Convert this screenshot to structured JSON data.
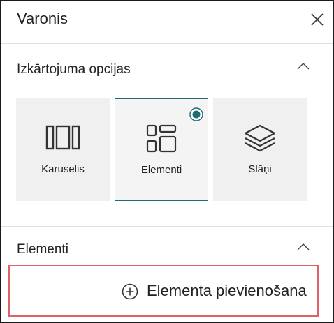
{
  "panel": {
    "title": "Varonis",
    "close_icon": "close-icon"
  },
  "layout_section": {
    "title": "Izkārtojuma opcijas",
    "chevron_icon": "chevron-up-icon",
    "options": [
      {
        "label": "Karuselis",
        "icon": "carousel-icon",
        "selected": false
      },
      {
        "label": "Elementi",
        "icon": "grid-icon",
        "selected": true
      },
      {
        "label": "Slāņi",
        "icon": "layers-icon",
        "selected": false
      }
    ]
  },
  "elements_section": {
    "title": "Elementi",
    "chevron_icon": "chevron-up-icon",
    "add_button_label": "Elementa pievienošana",
    "add_icon": "add-circle-icon"
  },
  "colors": {
    "accent": "#1f6b73",
    "highlight": "#e06067",
    "tile_bg": "#f0f0f0"
  }
}
